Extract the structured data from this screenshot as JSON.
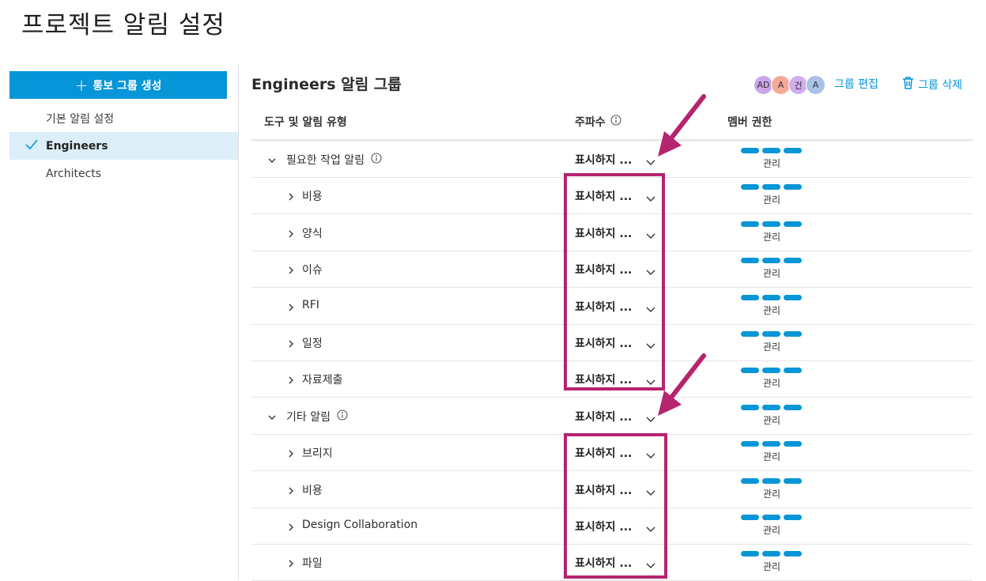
{
  "page": {
    "title": "프로젝트 알림 설정"
  },
  "sidebar": {
    "create_button": "통보 그룹 생성",
    "items": [
      {
        "label": "기본 알림 설정",
        "active": false
      },
      {
        "label": "Engineers",
        "active": true
      },
      {
        "label": "Architects",
        "active": false
      }
    ]
  },
  "group": {
    "title": "Engineers 알림 그룹",
    "avatars": [
      {
        "initials": "AD",
        "color": "#c9a7e8"
      },
      {
        "initials": "A",
        "color": "#f4a99b"
      },
      {
        "initials": "건",
        "color": "#d2aef0"
      },
      {
        "initials": "A",
        "color": "#a9c1e6"
      }
    ],
    "edit_label": "그룹 편집",
    "delete_label": "그룹 삭제"
  },
  "table": {
    "headers": {
      "tool": "도구 및 알림 유형",
      "frequency": "주파수",
      "permission": "멤버 권한"
    },
    "rows": [
      {
        "name": "필요한 작업 알림",
        "section": true,
        "info": true,
        "frequency": "표시하지 ...",
        "permission": "관리"
      },
      {
        "name": "비용",
        "section": false,
        "frequency": "표시하지 ...",
        "permission": "관리"
      },
      {
        "name": "양식",
        "section": false,
        "frequency": "표시하지 ...",
        "permission": "관리"
      },
      {
        "name": "이슈",
        "section": false,
        "frequency": "표시하지 ...",
        "permission": "관리"
      },
      {
        "name": "RFI",
        "section": false,
        "frequency": "표시하지 ...",
        "permission": "관리"
      },
      {
        "name": "일정",
        "section": false,
        "frequency": "표시하지 ...",
        "permission": "관리"
      },
      {
        "name": "자료제출",
        "section": false,
        "frequency": "표시하지 ...",
        "permission": "관리"
      },
      {
        "name": "기타 알림",
        "section": true,
        "info": true,
        "frequency": "표시하지 ...",
        "permission": "관리"
      },
      {
        "name": "브리지",
        "section": false,
        "frequency": "표시하지 ...",
        "permission": "관리"
      },
      {
        "name": "비용",
        "section": false,
        "frequency": "표시하지 ...",
        "permission": "관리"
      },
      {
        "name": "Design Collaboration",
        "section": false,
        "frequency": "표시하지 ...",
        "permission": "관리"
      },
      {
        "name": "파일",
        "section": false,
        "frequency": "표시하지 ...",
        "permission": "관리"
      }
    ]
  },
  "colors": {
    "accent": "#0696d7",
    "highlight": "#b5246e",
    "active_bg": "#dceef8"
  }
}
